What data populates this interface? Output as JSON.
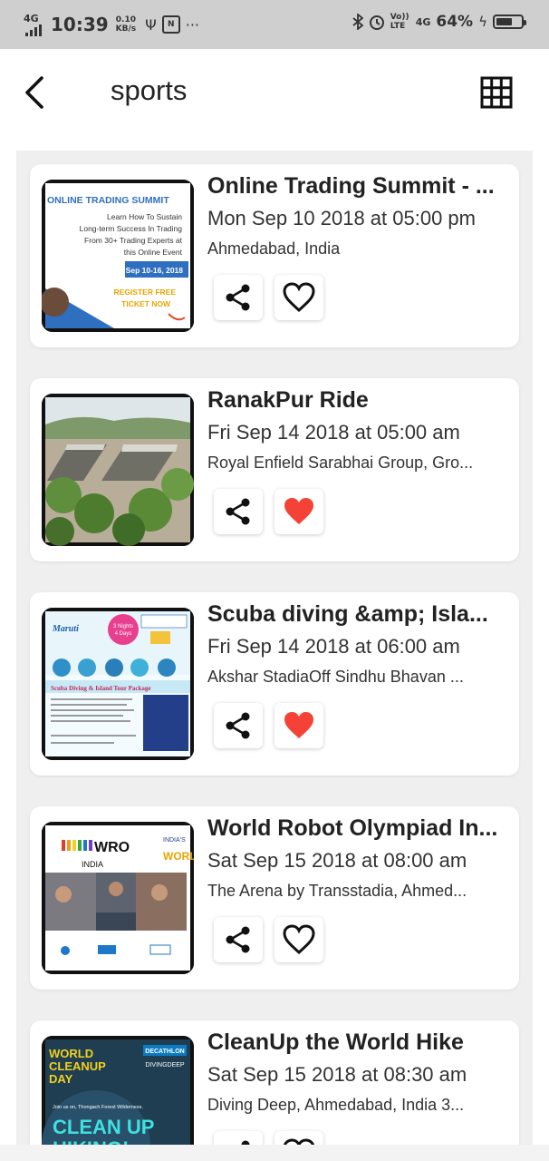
{
  "status_bar": {
    "network": "4G",
    "time": "10:39",
    "speed_value": "0.10",
    "speed_unit": "KB/s",
    "volte": "Vo)) LTE",
    "network_right": "4G",
    "battery_percent": "64%",
    "battery_level": 0.64
  },
  "app_bar": {
    "title": "sports"
  },
  "events": [
    {
      "title": "Online Trading Summit - ...",
      "date": "Mon Sep 10 2018 at 05:00 pm",
      "venue": "Ahmedabad, India",
      "favorited": false,
      "poster": {
        "heading": "ONLINE TRADING SUMMIT",
        "line1": "Learn How To Sustain",
        "line2": "Long-term Success In Trading",
        "line3": "From 30+ Trading Experts at",
        "line4": "this Online Event",
        "dates": "Sep 10-16, 2018",
        "cta1": "REGISTER FREE",
        "cta2": "TICKET NOW"
      }
    },
    {
      "title": "RanakPur Ride",
      "date": "Fri Sep 14 2018 at 05:00 am",
      "venue": "Royal Enfield Sarabhai Group, Gro...",
      "favorited": true
    },
    {
      "title": "Scuba diving &amp; Isla...",
      "date": "Fri Sep 14 2018 at 06:00 am",
      "venue": "Akshar StadiaOff Sindhu Bhavan ...",
      "favorited": true,
      "poster": {
        "brand": "Maruti",
        "badge1": "3 Nights",
        "badge2": "4 Days",
        "headline": "Scuba Diving & Island Tour Package"
      }
    },
    {
      "title": "World Robot Olympiad In...",
      "date": "Sat Sep 15 2018 at 08:00 am",
      "venue": "The Arena by Transstadia, Ahmed...",
      "favorited": false,
      "poster": {
        "logo": "WRO",
        "country": "INDIA",
        "side1": "INDIA'S",
        "side2": "WORL"
      }
    },
    {
      "title": "CleanUp the World Hike",
      "date": "Sat Sep 15 2018 at 08:30 am",
      "venue": "Diving Deep, Ahmedabad, India 3...",
      "favorited": false,
      "poster": {
        "line1": "WORLD",
        "line2": "CLEANUP",
        "line3": "DAY",
        "brand": "DECATHLON",
        "brand2": "DIVINGDEEP",
        "tagline": "Join us on, Thongach Forest Wilderness.",
        "big": "CLEAN UP",
        "big2": "HIKING!"
      }
    }
  ],
  "colors": {
    "heart_filled": "#f44336",
    "list_background": "#efefef",
    "status_bar": "#cfcfcf"
  }
}
